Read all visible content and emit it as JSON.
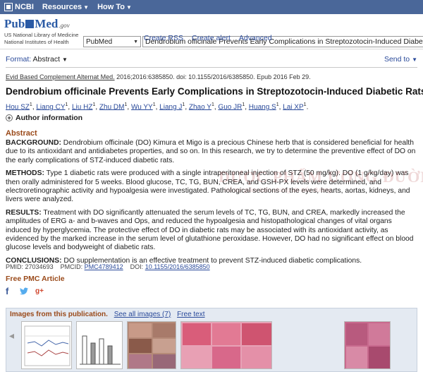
{
  "topbar": {
    "ncbi": "NCBI",
    "resources": "Resources",
    "howto": "How To"
  },
  "logo": {
    "word_pub": "Pub",
    "word_med": "Med",
    "gov": ".gov",
    "line1": "US National Library of Medicine",
    "line2": "National Institutes of Health"
  },
  "search": {
    "database": "PubMed",
    "query": "Dendrobium officinale Prevents Early Complications in Streptozotocin-Induced Diabetic"
  },
  "header_links": [
    "Create RSS",
    "Create alert",
    "Advanced"
  ],
  "format": {
    "label": "Format:",
    "value": "Abstract",
    "send_to": "Send to"
  },
  "article": {
    "journal": "Evid Based Complement Alternat Med.",
    "citation_rest": " 2016;2016:6385850. doi: 10.1155/2016/6385850. Epub 2016 Feb 29.",
    "title": "Dendrobium officinale Prevents Early Complications in Streptozotocin-Induced Diabetic Rats.",
    "authors": [
      {
        "name": "Hou SZ",
        "sup": "1"
      },
      {
        "name": "Liang CY",
        "sup": "1"
      },
      {
        "name": "Liu HZ",
        "sup": "1"
      },
      {
        "name": "Zhu DM",
        "sup": "1"
      },
      {
        "name": "Wu YY",
        "sup": "1"
      },
      {
        "name": "Liang J",
        "sup": "1"
      },
      {
        "name": "Zhao Y",
        "sup": "1"
      },
      {
        "name": "Guo JR",
        "sup": "1"
      },
      {
        "name": "Huang S",
        "sup": "1"
      },
      {
        "name": "Lai XP",
        "sup": "1"
      }
    ],
    "author_info": "Author information"
  },
  "abstract": {
    "heading": "Abstract",
    "sections": [
      {
        "label": "BACKGROUND:",
        "text": " Dendrobium officinale (DO) Kimura et Migo is a precious Chinese herb that is considered beneficial for health due to its antioxidant and antidiabetes properties, and so on. In this research, we try to determine the preventive effect of DO on the early complications of STZ-induced diabetic rats."
      },
      {
        "label": "METHODS:",
        "text": " Type 1 diabetic rats were produced with a single intraperitoneal injection of STZ (50 mg/kg). DO (1 g/kg/day) was then orally administered for 5 weeks. Blood glucose, TC, TG, BUN, CREA, and GSH-PX levels were determined, and electroretinographic activity and hypoalgesia were investigated. Pathological sections of the eyes, hearts, aortas, kidneys, and livers were analyzed."
      },
      {
        "label": "RESULTS:",
        "text": " Treatment with DO significantly attenuated the serum levels of TC, TG, BUN, and CREA, markedly increased the amplitudes of ERG a- and b-waves and Ops, and reduced the hypoalgesia and histopathological changes of vital organs induced by hyperglycemia. The protective effect of DO in diabetic rats may be associated with its antioxidant activity, as evidenced by the marked increase in the serum level of glutathione peroxidase. However, DO had no significant effect on blood glucose levels and bodyweight of diabetic rats."
      },
      {
        "label": "CONCLUSIONS:",
        "text": " DO supplementation is an effective treatment to prevent STZ-induced diabetic complications."
      }
    ]
  },
  "ids": {
    "pmid_label": "PMID:",
    "pmid": "27034693",
    "pmcid_label": "PMCID:",
    "pmcid": "PMC4789412",
    "doi_label": "DOI:",
    "doi": "10.1155/2016/6385850"
  },
  "free_pmc": "Free PMC Article",
  "images": {
    "title": "Images from this publication.",
    "see_all": "See all images (7)",
    "free_text": "Free text"
  },
  "watermark": {
    "line1": "DƯỢC PHẨM ƯƠNG ĐƯỜNG KHANG",
    "line2": "Hỗ trợ giảm biến chứng do tiểu đường"
  },
  "colors": {
    "topbar": "#4a6799",
    "link": "#2a4a9a",
    "heading": "#9a4a1a",
    "panel": "#e4eaf2"
  }
}
